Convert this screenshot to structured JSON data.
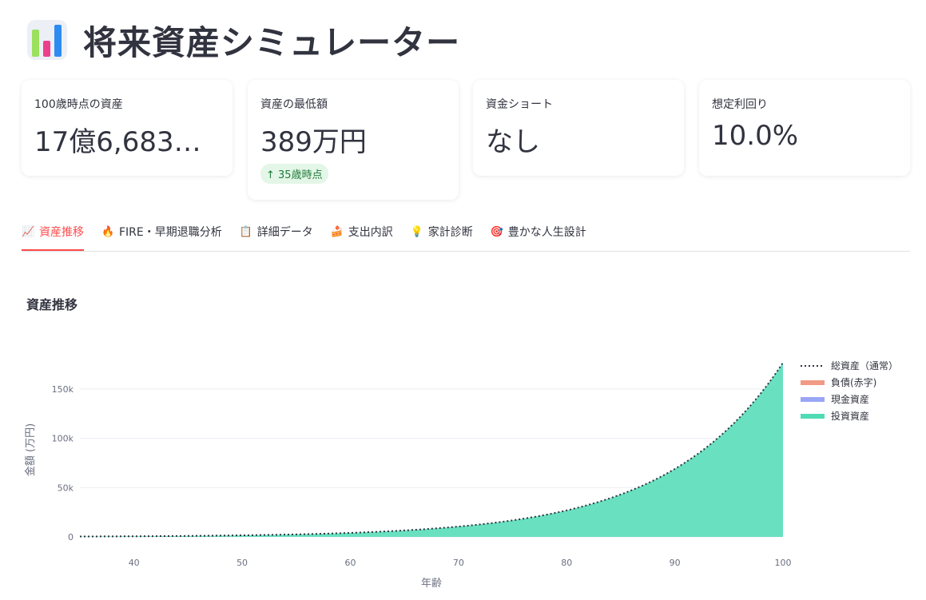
{
  "app": {
    "title": "将来資産シミュレーター",
    "icon": "bar-chart-icon"
  },
  "metrics": [
    {
      "label": "100歳時点の資産",
      "value": "17億6,683…"
    },
    {
      "label": "資産の最低額",
      "value": "389万円",
      "delta": "35歳時点",
      "delta_icon": "arrow-up-icon",
      "delta_color": "#1f7a3b"
    },
    {
      "label": "資金ショート",
      "value": "なし"
    },
    {
      "label": "想定利回り",
      "value": "10.0%"
    }
  ],
  "tabs": [
    {
      "label": "資産推移",
      "icon": "chart-increasing-icon",
      "active": true
    },
    {
      "label": "FIRE・早期退職分析",
      "icon": "fire-icon"
    },
    {
      "label": "詳細データ",
      "icon": "clipboard-icon"
    },
    {
      "label": "支出内訳",
      "icon": "cake-icon"
    },
    {
      "label": "家計診断",
      "icon": "lightbulb-icon"
    },
    {
      "label": "豊かな人生設計",
      "icon": "target-icon"
    }
  ],
  "section": {
    "title": "資産推移"
  },
  "colors": {
    "accent": "#ff4b4b",
    "invest": "#4fdcb5",
    "cash": "#9aa6f5",
    "debt": "#f19a85",
    "total": "#2e3440"
  },
  "chart_data": {
    "type": "area",
    "xlabel": "年齢",
    "ylabel": "金額 (万円)",
    "xlim": [
      35,
      100
    ],
    "ylim": [
      0,
      176683
    ],
    "x_ticks": [
      40,
      50,
      60,
      70,
      80,
      90,
      100
    ],
    "y_ticks": [
      0,
      50000,
      100000,
      150000
    ],
    "y_tick_labels": [
      "0",
      "50k",
      "100k",
      "150k"
    ],
    "legend_position": "top-right",
    "series": [
      {
        "name": "総資産（通常）",
        "style": "dotted-line",
        "color": "#2e3440",
        "x": [
          35,
          100
        ],
        "y": [
          389,
          176683
        ],
        "growth": "exponential"
      },
      {
        "name": "負債(赤字)",
        "style": "area",
        "color": "#f19a85",
        "x": [
          35,
          100
        ],
        "y": [
          0,
          0
        ]
      },
      {
        "name": "現金資産",
        "style": "area",
        "color": "#9aa6f5",
        "x": [
          35,
          100
        ],
        "y": [
          0,
          0
        ]
      },
      {
        "name": "投資資産",
        "style": "area",
        "color": "#4fdcb5",
        "x": [
          35,
          100
        ],
        "y": [
          389,
          176683
        ],
        "growth": "exponential"
      }
    ]
  }
}
